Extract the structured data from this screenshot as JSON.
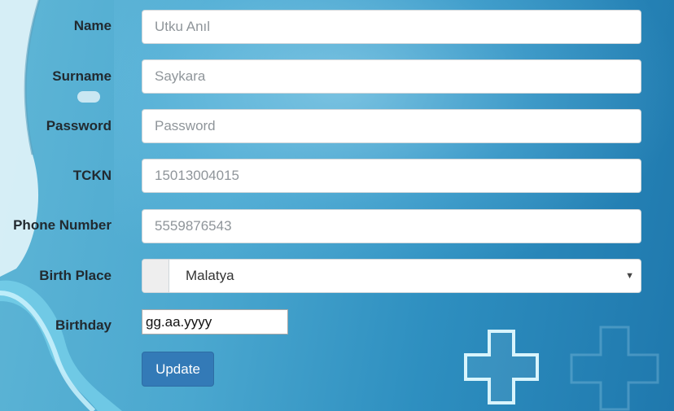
{
  "form": {
    "name": {
      "label": "Name",
      "value": "Utku Anıl"
    },
    "surname": {
      "label": "Surname",
      "value": "Saykara"
    },
    "password": {
      "label": "Password",
      "placeholder": "Password"
    },
    "tckn": {
      "label": "TCKN",
      "value": "15013004015"
    },
    "phone": {
      "label": "Phone Number",
      "value": "5559876543"
    },
    "birth_place": {
      "label": "Birth Place",
      "selected": "Malatya"
    },
    "birthday": {
      "label": "Birthday",
      "value": "gg.aa.yyyy"
    },
    "update_label": "Update"
  },
  "icons": {
    "select_caret": "caret-down-icon",
    "background_cross": "medical-cross-icon",
    "background_stethoscope": "stethoscope-icon"
  },
  "colors": {
    "primary_button": "#337ab7",
    "background": "#4aa7cf"
  }
}
